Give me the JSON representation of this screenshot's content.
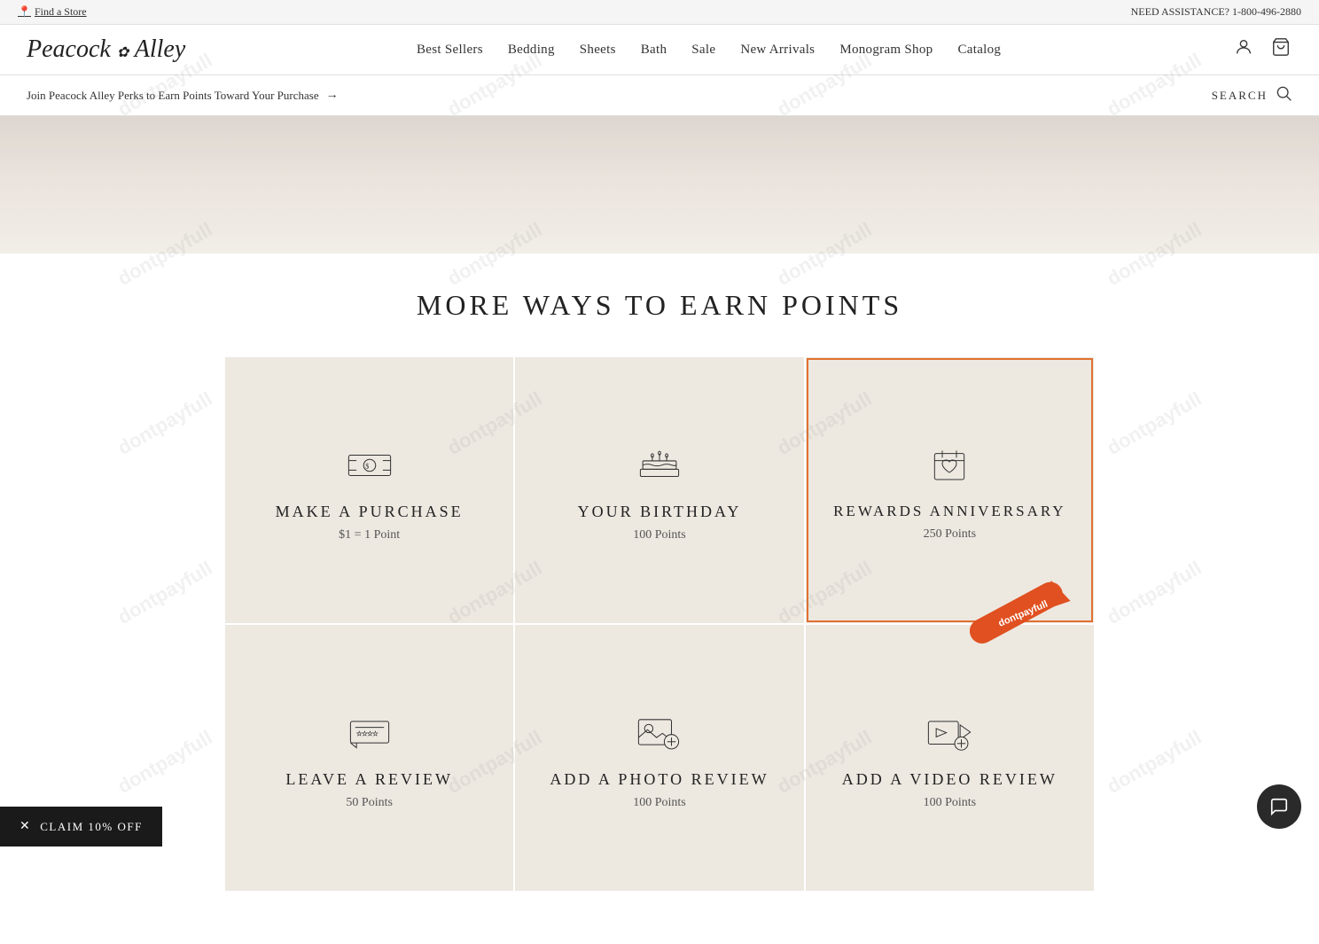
{
  "topbar": {
    "find_store": "Find a Store",
    "assistance": "NEED ASSISTANCE? 1-800-496-2880"
  },
  "header": {
    "logo": "Peacock Alley",
    "nav": [
      {
        "label": "Best Sellers",
        "id": "best-sellers"
      },
      {
        "label": "Bedding",
        "id": "bedding"
      },
      {
        "label": "Sheets",
        "id": "sheets"
      },
      {
        "label": "Bath",
        "id": "bath"
      },
      {
        "label": "Sale",
        "id": "sale"
      },
      {
        "label": "New Arrivals",
        "id": "new-arrivals"
      },
      {
        "label": "Monogram Shop",
        "id": "monogram-shop"
      },
      {
        "label": "Catalog",
        "id": "catalog"
      }
    ]
  },
  "perks_bar": {
    "text": "Join Peacock Alley Perks to Earn Points Toward Your Purchase",
    "arrow": "→",
    "search_label": "SEARCH"
  },
  "main": {
    "section_title": "MORE WAYS TO EARN POINTS",
    "cards": [
      {
        "id": "make-purchase",
        "title": "MAKE A PURCHASE",
        "points": "$1 = 1 Point",
        "highlighted": false
      },
      {
        "id": "your-birthday",
        "title": "YOUR BIRTHDAY",
        "points": "100 Points",
        "highlighted": false
      },
      {
        "id": "rewards-anniversary",
        "title": "REWARDS ANNIVERSARY",
        "points": "250 Points",
        "highlighted": true
      },
      {
        "id": "leave-review",
        "title": "LEAVE A REVIEW",
        "points": "50 Points",
        "highlighted": false
      },
      {
        "id": "add-photo",
        "title": "ADD A PHOTO REVIEW",
        "points": "100 Points",
        "highlighted": false
      },
      {
        "id": "add-video",
        "title": "ADD A VIDEO REVIEW",
        "points": "100 Points",
        "highlighted": false
      }
    ]
  },
  "claim_bar": {
    "label": "CLAIM 10% OFF"
  },
  "watermark": "dontpayfull"
}
